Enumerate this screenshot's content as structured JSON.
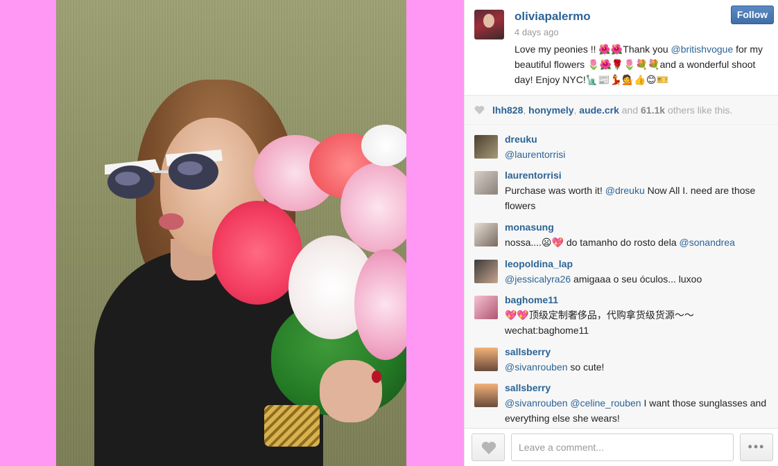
{
  "post": {
    "username": "oliviapalermo",
    "time": "4 days ago",
    "follow_label": "Follow",
    "caption_parts": {
      "part1": "Love my peonies !! 🌺🌺Thank you ",
      "mention1": "@britishvogue",
      "part2": " for my beautiful flowers 🌷🌺🌹🌷💐💐and a wonderful shoot day! Enjoy NYC!🗽📰💃💁👍😊🎫"
    }
  },
  "likes": {
    "users": [
      "lhh828",
      "honymely",
      "aude.crk"
    ],
    "sep": ", ",
    "and": " and ",
    "count": "61.1k",
    "suffix": " others like this."
  },
  "comments": [
    {
      "user": "dreuku",
      "mentions": "@laurentorrisi",
      "text": ""
    },
    {
      "user": "laurentorrisi",
      "text_pre": "Purchase was worth it! ",
      "mention": "@dreuku",
      "text_post": " Now All I. need are those flowers"
    },
    {
      "user": "monasung",
      "text_pre": "nossa....😦💖 do tamanho do rosto dela ",
      "mention": "@sonandrea",
      "text_post": ""
    },
    {
      "user": "leopoldina_lap",
      "text_pre": "",
      "mention": "@jessicalyra26",
      "text_post": " amigaaa o seu óculos... luxoo"
    },
    {
      "user": "baghome11",
      "text_pre": "💖💖顶级定制奢侈品，代购拿货级货源～～ wechat:baghome11",
      "mention": "",
      "text_post": ""
    },
    {
      "user": "sallsberry",
      "text_pre": "",
      "mention": "@sivanrouben",
      "text_post": " so cute!"
    },
    {
      "user": "sallsberry",
      "text_pre": "",
      "mention": "@sivanrouben",
      "mention2": "@celine_rouben",
      "text_post": " I want those sunglasses and everything else she wears!"
    }
  ],
  "footer": {
    "comment_placeholder": "Leave a comment...",
    "more_label": "•••"
  },
  "colors": {
    "link": "#2b6396",
    "follow_bg": "#4a7bb4",
    "background_pink": "#ff97f5"
  },
  "icons": {
    "heart": "heart-icon",
    "more": "more-dots-icon"
  }
}
